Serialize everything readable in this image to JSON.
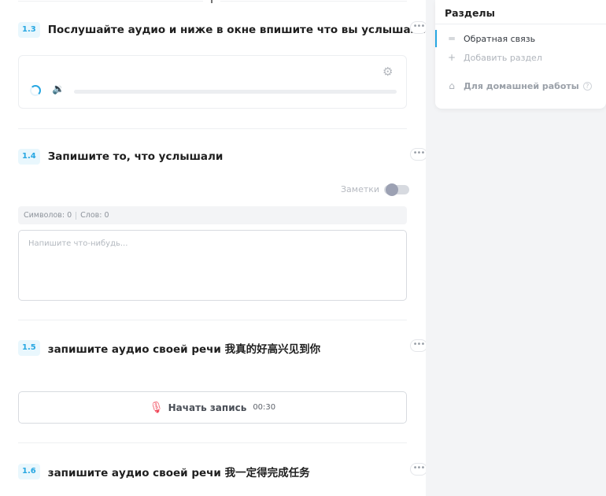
{
  "tasks": {
    "t13": {
      "num": "1.3",
      "title": "Послушайте аудио и ниже в окне впишите что вы услышали"
    },
    "t14": {
      "num": "1.4",
      "title": "Запишите то, что услышали"
    },
    "t15": {
      "num": "1.5",
      "title": "запишите аудио своей речи  我真的好高兴见到你"
    },
    "t16": {
      "num": "1.6",
      "title": "запишите аудио своей речи  我一定得完成任务"
    }
  },
  "add_button": "+",
  "more_button": "•••",
  "notes": {
    "label": "Заметки",
    "enabled": false
  },
  "counter": {
    "chars": "Символов: 0",
    "words": "Слов: 0"
  },
  "textarea": {
    "placeholder": "Напишите что-нибудь..."
  },
  "record": {
    "label": "Начать запись",
    "time": "00:30"
  },
  "audio": {
    "progress": 0
  },
  "sidebar": {
    "title": "Разделы",
    "items": [
      {
        "icon": "lines-icon",
        "label": "Обратная связь",
        "active": true
      },
      {
        "icon": "plus-icon",
        "label": "Добавить раздел",
        "active": false
      },
      {
        "icon": "home-icon",
        "label": "Для домашней работы",
        "active": false
      }
    ]
  },
  "colors": {
    "accent": "#27a7e2",
    "mic": "#f0485a",
    "panel_bg": "#f3f4f6"
  },
  "icons": [
    "gear-icon",
    "spinner-icon",
    "volume-icon",
    "mic-icon",
    "help-icon",
    "more-icon"
  ]
}
